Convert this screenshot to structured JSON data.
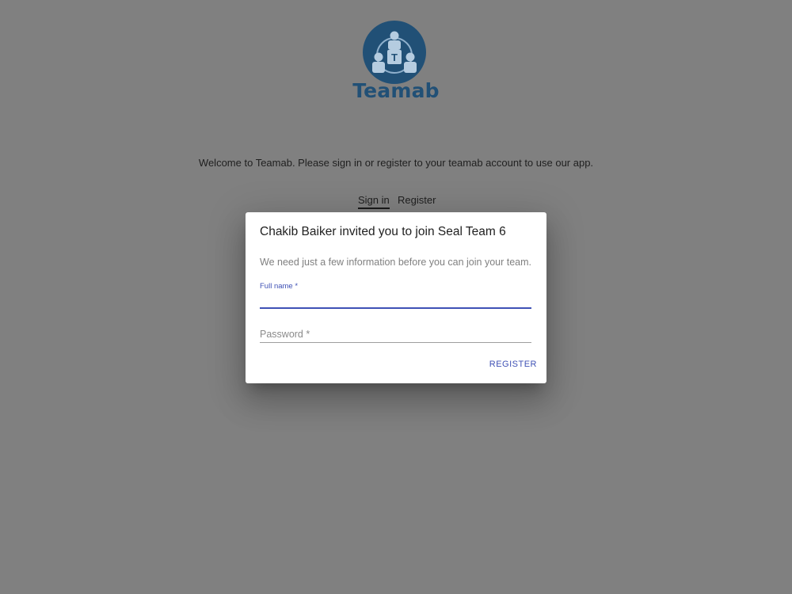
{
  "brand": {
    "logo_icon": "team-network-icon",
    "logo_letter": "T",
    "name": "Teamab",
    "color": "#215076"
  },
  "welcome_text": "Welcome to Teamab. Please sign in or register to your teamab account to use our app.",
  "tabs": [
    {
      "label": "Sign in",
      "active": true
    },
    {
      "label": "Register",
      "active": false
    }
  ],
  "dialog": {
    "title": "Chakib Baiker invited you to join Seal Team 6",
    "text": "We need just a few information before you can join your team.",
    "full_name": {
      "label": "Full name *",
      "value": ""
    },
    "password": {
      "placeholder": "Password *",
      "value": ""
    },
    "register_label": "REGISTER",
    "accent_color": "#3f51b5"
  },
  "backdrop_color": "#808080"
}
